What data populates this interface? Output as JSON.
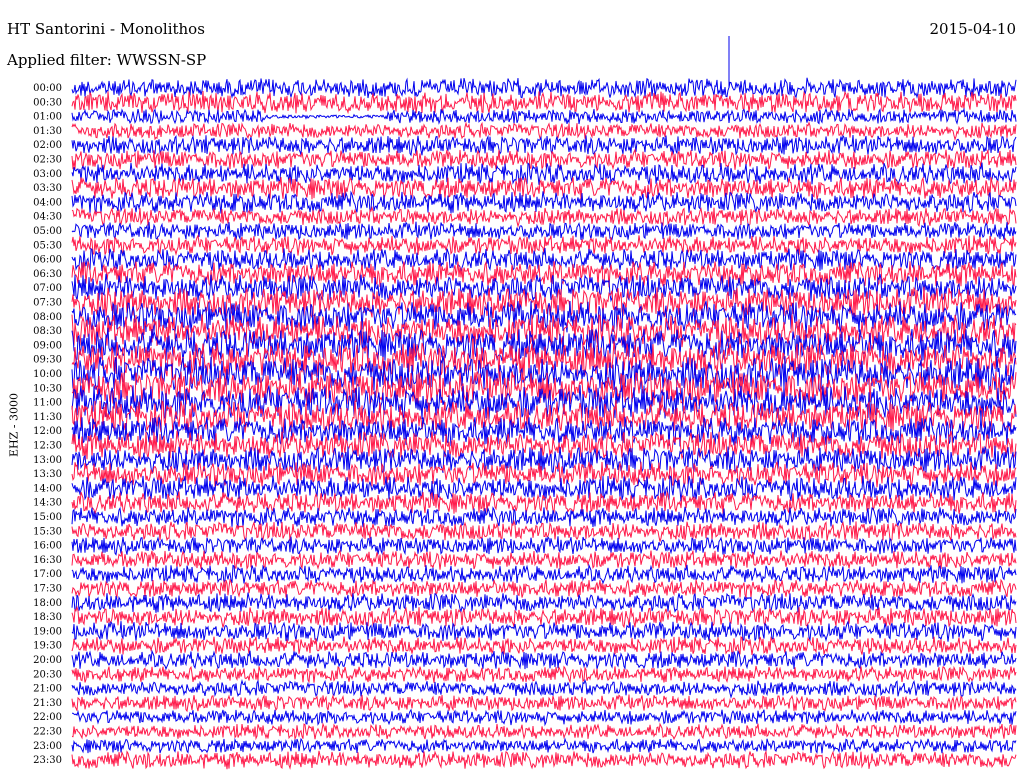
{
  "header": {
    "station": "HT Santorini - Monolithos",
    "date": "2015-04-10",
    "filter": "Applied filter: WWSSN-SP",
    "channel": "EHZ - 3000"
  },
  "chart_data": {
    "type": "line",
    "title": "HT Santorini - Monolithos",
    "date": "2015-04-10",
    "filter": "WWSSN-SP",
    "channel": "EHZ - 3000",
    "trace_colors": [
      "#0000ee",
      "#ff1a4a"
    ],
    "grid": false,
    "rows": [
      {
        "time": "00:00",
        "amp": 0.55
      },
      {
        "time": "00:30",
        "amp": 0.62
      },
      {
        "time": "01:00",
        "amp": 0.42
      },
      {
        "time": "01:30",
        "amp": 0.45
      },
      {
        "time": "02:00",
        "amp": 0.55
      },
      {
        "time": "02:30",
        "amp": 0.55
      },
      {
        "time": "03:00",
        "amp": 0.6
      },
      {
        "time": "03:30",
        "amp": 0.62
      },
      {
        "time": "04:00",
        "amp": 0.6
      },
      {
        "time": "04:30",
        "amp": 0.5
      },
      {
        "time": "05:00",
        "amp": 0.5
      },
      {
        "time": "05:30",
        "amp": 0.55
      },
      {
        "time": "06:00",
        "amp": 0.62
      },
      {
        "time": "06:30",
        "amp": 0.72
      },
      {
        "time": "07:00",
        "amp": 0.78
      },
      {
        "time": "07:30",
        "amp": 0.85
      },
      {
        "time": "08:00",
        "amp": 0.9
      },
      {
        "time": "08:30",
        "amp": 0.92
      },
      {
        "time": "09:00",
        "amp": 0.95
      },
      {
        "time": "09:30",
        "amp": 1.0
      },
      {
        "time": "10:00",
        "amp": 1.0
      },
      {
        "time": "10:30",
        "amp": 1.0
      },
      {
        "time": "11:00",
        "amp": 0.98
      },
      {
        "time": "11:30",
        "amp": 0.9
      },
      {
        "time": "12:00",
        "amp": 0.82
      },
      {
        "time": "12:30",
        "amp": 0.8
      },
      {
        "time": "13:00",
        "amp": 0.75
      },
      {
        "time": "13:30",
        "amp": 0.7
      },
      {
        "time": "14:00",
        "amp": 0.7
      },
      {
        "time": "14:30",
        "amp": 0.6
      },
      {
        "time": "15:00",
        "amp": 0.55
      },
      {
        "time": "15:30",
        "amp": 0.55
      },
      {
        "time": "16:00",
        "amp": 0.5
      },
      {
        "time": "16:30",
        "amp": 0.52
      },
      {
        "time": "17:00",
        "amp": 0.5
      },
      {
        "time": "17:30",
        "amp": 0.5
      },
      {
        "time": "18:00",
        "amp": 0.55
      },
      {
        "time": "18:30",
        "amp": 0.55
      },
      {
        "time": "19:00",
        "amp": 0.55
      },
      {
        "time": "19:30",
        "amp": 0.5
      },
      {
        "time": "20:00",
        "amp": 0.5
      },
      {
        "time": "20:30",
        "amp": 0.45
      },
      {
        "time": "21:00",
        "amp": 0.45
      },
      {
        "time": "21:30",
        "amp": 0.45
      },
      {
        "time": "22:00",
        "amp": 0.42
      },
      {
        "time": "22:30",
        "amp": 0.42
      },
      {
        "time": "23:00",
        "amp": 0.4
      },
      {
        "time": "23:30",
        "amp": 0.5
      }
    ]
  }
}
